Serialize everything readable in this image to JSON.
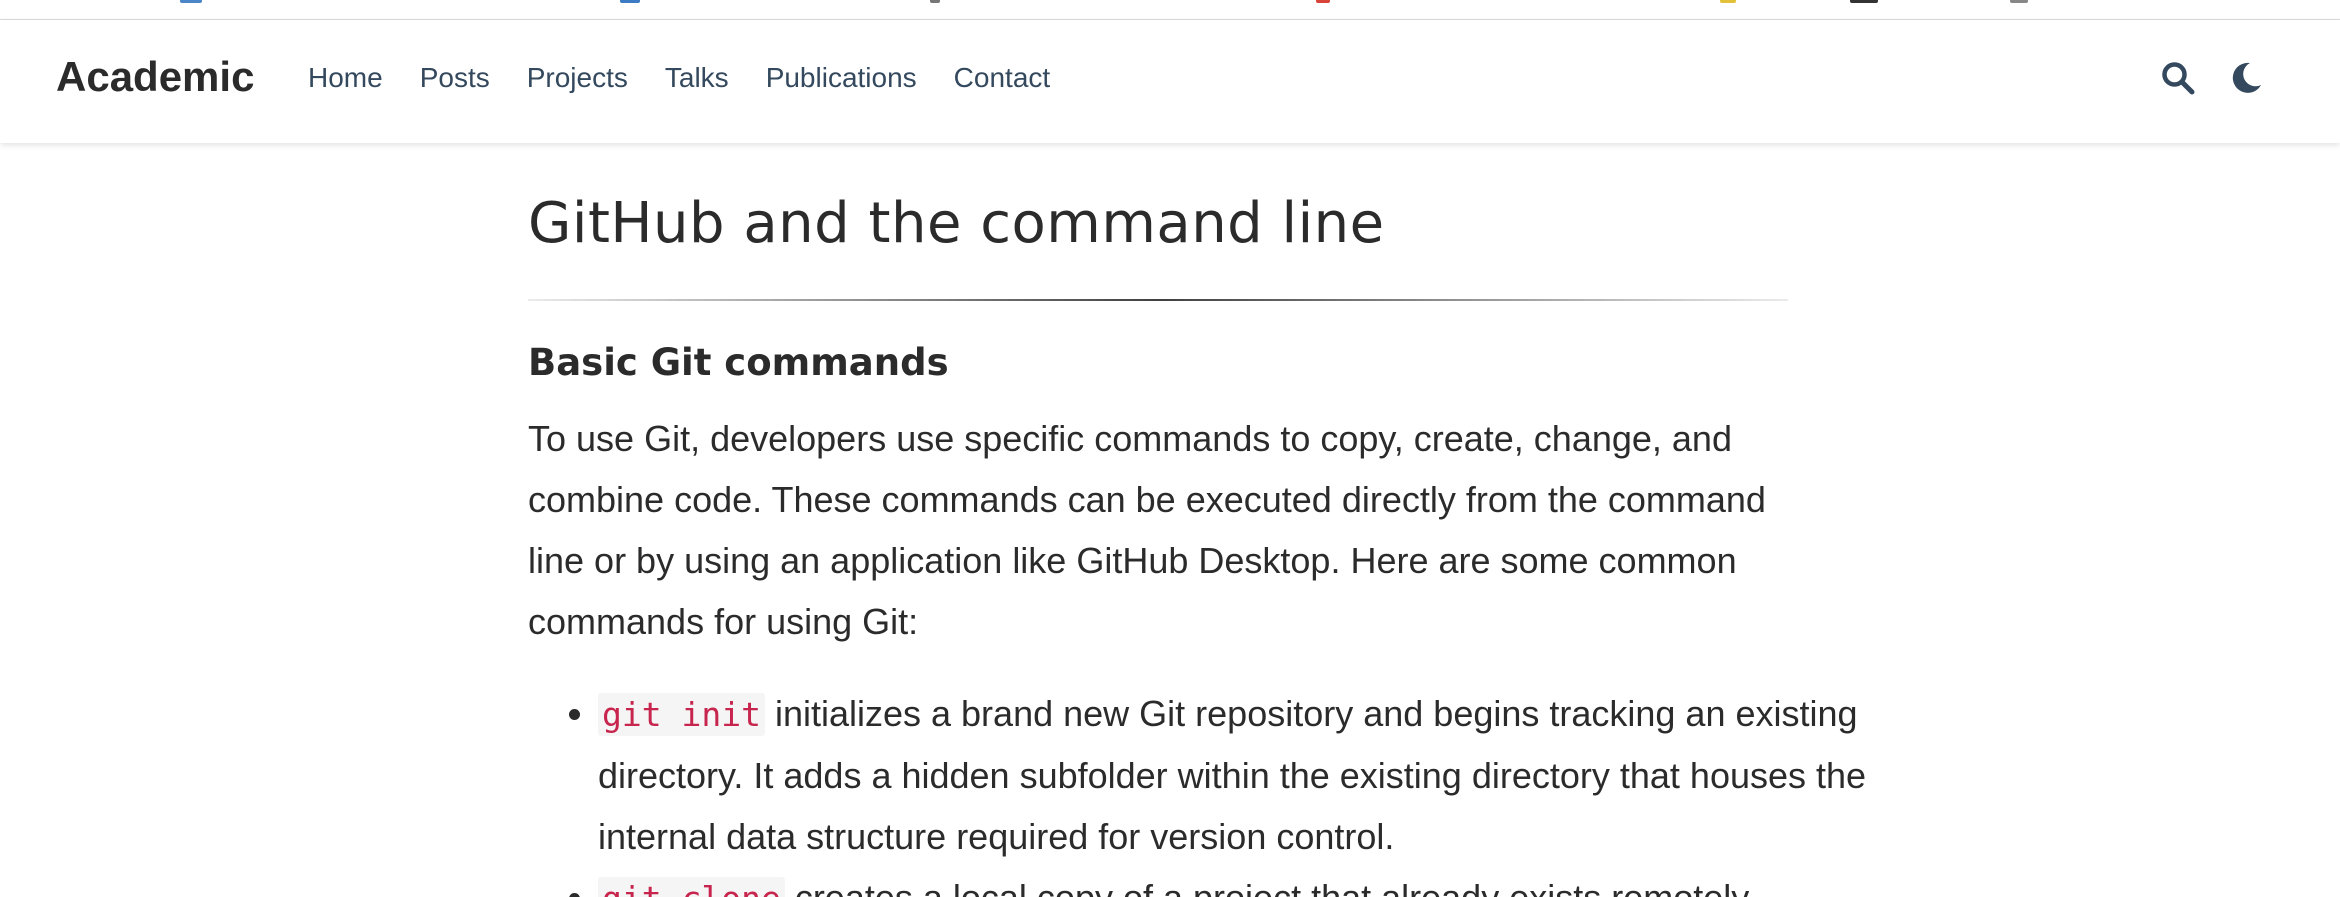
{
  "colors": {
    "brand_text": "#2b2b2b",
    "nav_link": "#34495e",
    "code_text": "#c7254e",
    "code_bg": "#f5f5f5"
  },
  "navbar": {
    "brand": "Academic",
    "links": [
      "Home",
      "Posts",
      "Projects",
      "Talks",
      "Publications",
      "Contact"
    ],
    "icons": [
      "search-icon",
      "moon-icon"
    ]
  },
  "content": {
    "section_title": "GitHub and the command line",
    "subsection_title": "Basic Git commands",
    "paragraph": "To use Git, developers use specific commands to copy, create, change, and combine code. These commands can be executed directly from the command line or by using an application like GitHub Desktop. Here are some common commands for using Git:",
    "list_items": [
      {
        "code": "git init",
        "text": " initializes a brand new Git repository and begins tracking an existing directory. It adds a hidden subfolder within the existing directory that houses the internal data structure required for version control."
      },
      {
        "code": "git clone",
        "text": " creates a local copy of a project that already exists remotely."
      }
    ]
  }
}
